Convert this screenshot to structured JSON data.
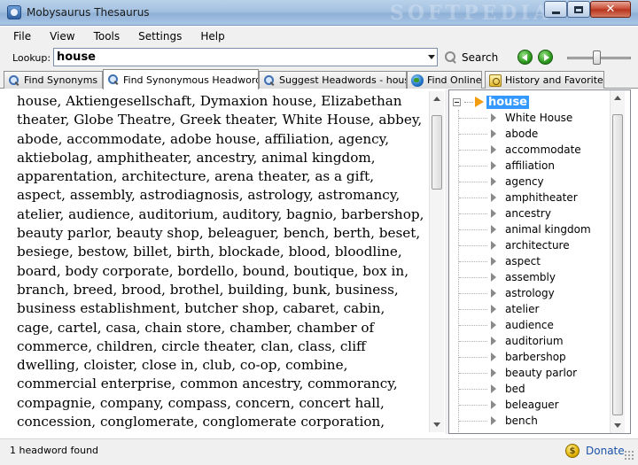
{
  "window": {
    "title": "Mobysaurus Thesaurus",
    "watermark": "SOFTPEDIA"
  },
  "menu": [
    "File",
    "View",
    "Tools",
    "Settings",
    "Help"
  ],
  "lookup": {
    "label": "Lookup:",
    "value": "house",
    "search_label": "Search"
  },
  "tabs": [
    {
      "label": "Find Synonyms",
      "icon": "magnify-icon",
      "active": false
    },
    {
      "label": "Find Synonymous Headwords",
      "icon": "magnify-icon",
      "active": true
    },
    {
      "label": "Suggest Headwords - house",
      "icon": "magnify-icon",
      "active": false
    },
    {
      "label": "Find Online",
      "icon": "globe-icon",
      "active": false
    },
    {
      "label": "History and Favorites",
      "icon": "history-icon",
      "active": false
    }
  ],
  "synonyms_text": "house, Aktiengesellschaft, Dymaxion house, Elizabethan theater, Globe Theatre, Greek theater, White House, abbey, abode, accommodate, adobe house, affiliation, agency, aktiebolag, amphitheater, ancestry, animal kingdom, apparentation, architecture, arena theater, as a gift, aspect, assembly, astrodiagnosis, astrology, astromancy, atelier, audience, auditorium, auditory, bagnio, barbershop, beauty parlor, beauty shop, beleaguer, bench, berth, beset, besiege, bestow, billet, birth, blockade, blood, bloodline, board, body corporate, bordello, bound, boutique, box in, branch, breed, brood, brothel, building, bunk, business, business establishment, butcher shop, cabaret, cabin, cage, cartel, casa, chain store, chamber, chamber of commerce, children, circle theater, clan, class, cliff dwelling, cloister, close in, club, co-op, combine, commercial enterprise, common ancestry, commorancy, compagnie, company, compass, concern, concert hall, concession, conglomerate, conglomerate corporation, congregation, congress, consanguinity, consolidating company, consortium",
  "tree": {
    "root": "house",
    "items": [
      "White House",
      "abode",
      "accommodate",
      "affiliation",
      "agency",
      "amphitheater",
      "ancestry",
      "animal kingdom",
      "architecture",
      "aspect",
      "assembly",
      "astrology",
      "atelier",
      "audience",
      "auditorium",
      "barbershop",
      "beauty parlor",
      "bed",
      "beleaguer",
      "bench"
    ]
  },
  "status": {
    "text": "1 headword found",
    "donate_label": "Donate"
  },
  "colors": {
    "selection": "#3399ff",
    "root_arrow": "#f39c12",
    "donate_link": "#1a52a8"
  }
}
